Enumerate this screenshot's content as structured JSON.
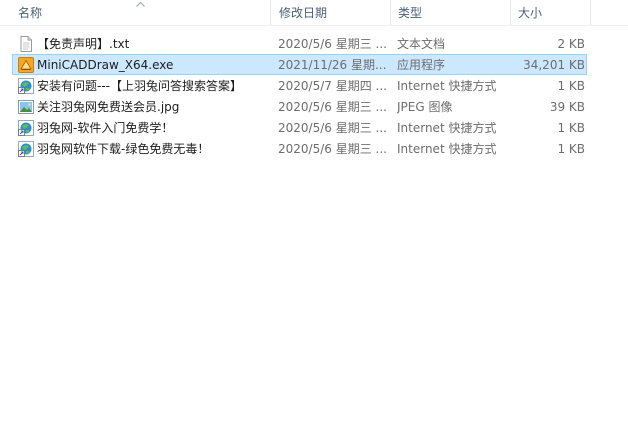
{
  "header": {
    "name": "名称",
    "date": "修改日期",
    "type": "类型",
    "size": "大小"
  },
  "files": [
    {
      "name": "【免责声明】.txt",
      "date": "2020/5/6 星期三 ...",
      "type": "文本文档",
      "size": "2 KB",
      "icon": "text-file-icon"
    },
    {
      "name": "MiniCADDraw_X64.exe",
      "date": "2021/11/26 星期...",
      "type": "应用程序",
      "size": "34,201 KB",
      "icon": "application-icon"
    },
    {
      "name": "安装有问题---【上羽兔问答搜索答案】",
      "date": "2020/5/7 星期四 ...",
      "type": "Internet 快捷方式",
      "size": "1 KB",
      "icon": "internet-shortcut-icon"
    },
    {
      "name": "关注羽兔网免费送会员.jpg",
      "date": "2020/5/6 星期三 ...",
      "type": "JPEG 图像",
      "size": "39 KB",
      "icon": "image-file-icon"
    },
    {
      "name": "羽兔网-软件入门免费学！",
      "date": "2020/5/6 星期三 ...",
      "type": "Internet 快捷方式",
      "size": "1 KB",
      "icon": "internet-shortcut-icon"
    },
    {
      "name": "羽兔网软件下载-绿色免费无毒！",
      "date": "2020/5/6 星期三 ...",
      "type": "Internet 快捷方式",
      "size": "1 KB",
      "icon": "internet-shortcut-icon"
    }
  ],
  "selected_index": 1,
  "colors": {
    "selection_bg": "#cce8ff",
    "selection_border": "#99d1ff",
    "header_text": "#4c607a",
    "detail_text": "#6d6d6d"
  }
}
